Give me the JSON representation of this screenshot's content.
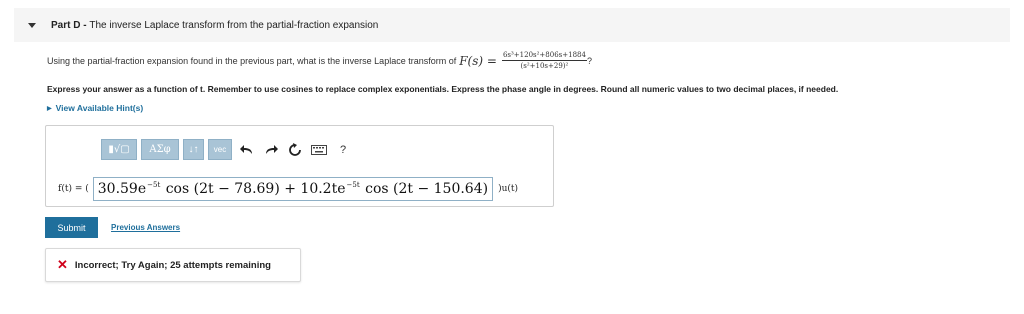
{
  "header": {
    "part_label": "Part D",
    "separator": " - ",
    "title": "The inverse Laplace transform from the partial-fraction expansion"
  },
  "question": {
    "text": "Using the partial-fraction expansion found in the previous part, what is the inverse Laplace transform of",
    "function_name": "F(s) =",
    "numerator": "6s³+120s²+806s+1884",
    "denominator": "(s²+10s+29)²",
    "end": "?"
  },
  "instructions": "Express your answer as a function of t. Remember to use cosines to replace complex exponentials. Express the phase angle in degrees. Round all numeric values to two decimal places, if needed.",
  "hints_link": "View Available Hint(s)",
  "toolbar": {
    "templates_label": "▮√▢",
    "greek_label": "ΑΣφ",
    "arrows_label": "↓↑",
    "vec_label": "vec",
    "help_label": "?"
  },
  "answer": {
    "label": "f(t) = (",
    "part1": "30.59e",
    "exp1": "−5t",
    "part2": "cos (2t − 78.69) + 10.2te",
    "exp2": "−5t",
    "part3": "cos (2t − 150.64)",
    "unit": ")u(t)"
  },
  "submit_label": "Submit",
  "previous_answers_label": "Previous Answers",
  "feedback": {
    "icon": "close-icon",
    "message": "Incorrect; Try Again; 25 attempts remaining"
  },
  "colors": {
    "accent": "#1f6f9c",
    "toolbar_button": "#a9c4d6",
    "error": "#d0021b"
  }
}
